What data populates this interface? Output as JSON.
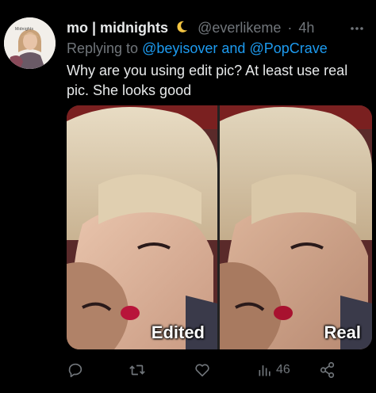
{
  "tweet": {
    "avatar_caption": "Midnights",
    "display_name": "mo | midnights",
    "handle": "@everlikeme",
    "separator": "·",
    "time": "4h",
    "reply_prefix": "Replying to",
    "mention_1": "@beyisover",
    "reply_joiner": "and",
    "mention_2": "@PopCrave",
    "text": "Why are you using edit pic? At least use real pic. She looks good"
  },
  "media": {
    "left_label": "Edited",
    "right_label": "Real"
  },
  "actions": {
    "views_count": "46"
  },
  "icons": {
    "name_emoji": "crescent-moon-icon",
    "more": "more-icon",
    "reply": "reply-icon",
    "retweet": "retweet-icon",
    "like": "heart-icon",
    "views": "views-chart-icon",
    "share": "share-icon"
  },
  "colors": {
    "background": "#000000",
    "primary_text": "#e7e9ea",
    "secondary_text": "#71767b",
    "link": "#1d9bf0"
  }
}
